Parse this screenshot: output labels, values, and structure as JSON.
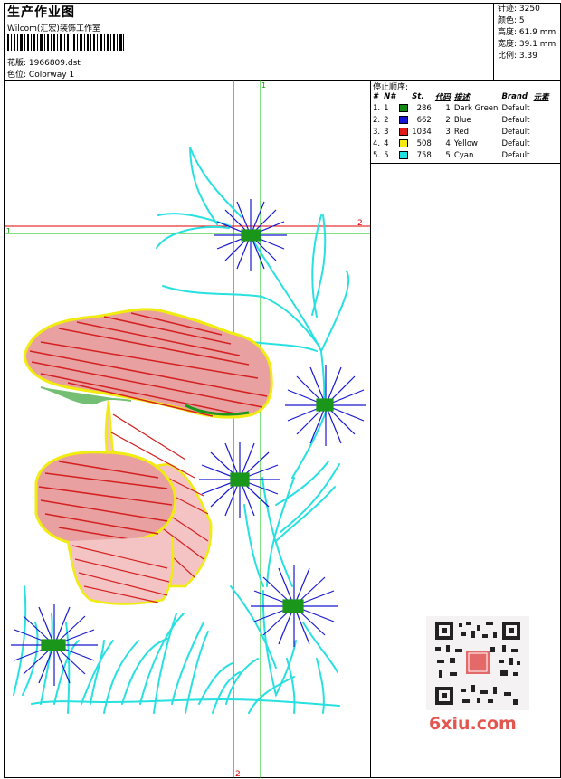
{
  "header": {
    "title": "生产作业图",
    "company": "Wilcom(汇宏)装饰工作室",
    "design_label": "花版:",
    "design_value": "1966809.dst",
    "colorway_label": "色位:",
    "colorway_value": "Colorway 1"
  },
  "stats": {
    "stitches": "针迹: 3250",
    "colors": "颜色: 5",
    "height": "高度: 61.9 mm",
    "width": "宽度: 39.1 mm",
    "ratio": "比例: 3.39"
  },
  "stop_sequence": {
    "title": "停止顺序:",
    "headers": [
      "#",
      "N#",
      "St.",
      "代码",
      "描述",
      "Brand",
      "元素"
    ],
    "rows": [
      {
        "num": "1.",
        "n": "1",
        "st": "286",
        "code": "1",
        "desc": "Dark Green",
        "brand": "Default",
        "color": "#138a13"
      },
      {
        "num": "2.",
        "n": "2",
        "st": "662",
        "code": "2",
        "desc": "Blue",
        "brand": "Default",
        "color": "#1515d4"
      },
      {
        "num": "3.",
        "n": "3",
        "st": "1034",
        "code": "3",
        "desc": "Red",
        "brand": "Default",
        "color": "#e21a1a"
      },
      {
        "num": "4.",
        "n": "4",
        "st": "508",
        "code": "4",
        "desc": "Yellow",
        "brand": "Default",
        "color": "#f2ea10"
      },
      {
        "num": "5.",
        "n": "5",
        "st": "758",
        "code": "5",
        "desc": "Cyan",
        "brand": "Default",
        "color": "#21e2e2"
      }
    ]
  },
  "guides": {
    "top_mark": "1",
    "left_mark": "1",
    "right_mark": "2",
    "bottom_mark": "2"
  },
  "watermark": "6xiu.com",
  "colors": {
    "red_guide": "#e00000",
    "green_guide": "#00c000",
    "red": "#d42020",
    "yellow": "#f0ec10",
    "blue": "#1818d0",
    "cyan": "#28e0e0",
    "green": "#1a961a"
  }
}
